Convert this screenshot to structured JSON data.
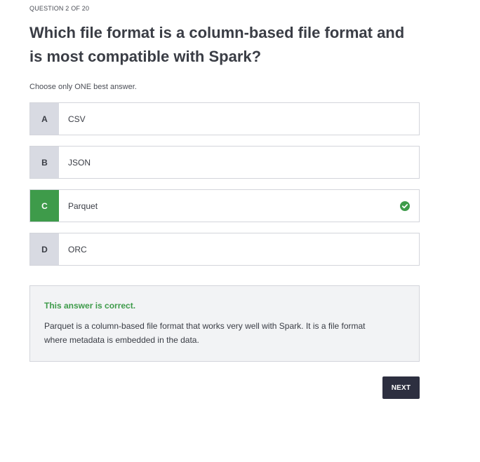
{
  "question": {
    "counter": "QUESTION 2 OF 20",
    "title": "Which file format is a column-based file format and is most compatible with Spark?",
    "instruction": "Choose only ONE best answer."
  },
  "options": [
    {
      "letter": "A",
      "text": "CSV",
      "state": "default"
    },
    {
      "letter": "B",
      "text": "JSON",
      "state": "default"
    },
    {
      "letter": "C",
      "text": "Parquet",
      "state": "correct",
      "icon": "check-circle-icon"
    },
    {
      "letter": "D",
      "text": "ORC",
      "state": "default"
    }
  ],
  "feedback": {
    "title": "This answer is correct.",
    "text": "Parquet is a column-based file format that works very well with Spark. It is a file format where metadata is embedded in the data."
  },
  "actions": {
    "next_label": "NEXT"
  },
  "colors": {
    "correct_green": "#3e9b4a",
    "letter_bg": "#d8dae2",
    "button_bg": "#2d2f40",
    "feedback_bg": "#f2f3f5"
  }
}
